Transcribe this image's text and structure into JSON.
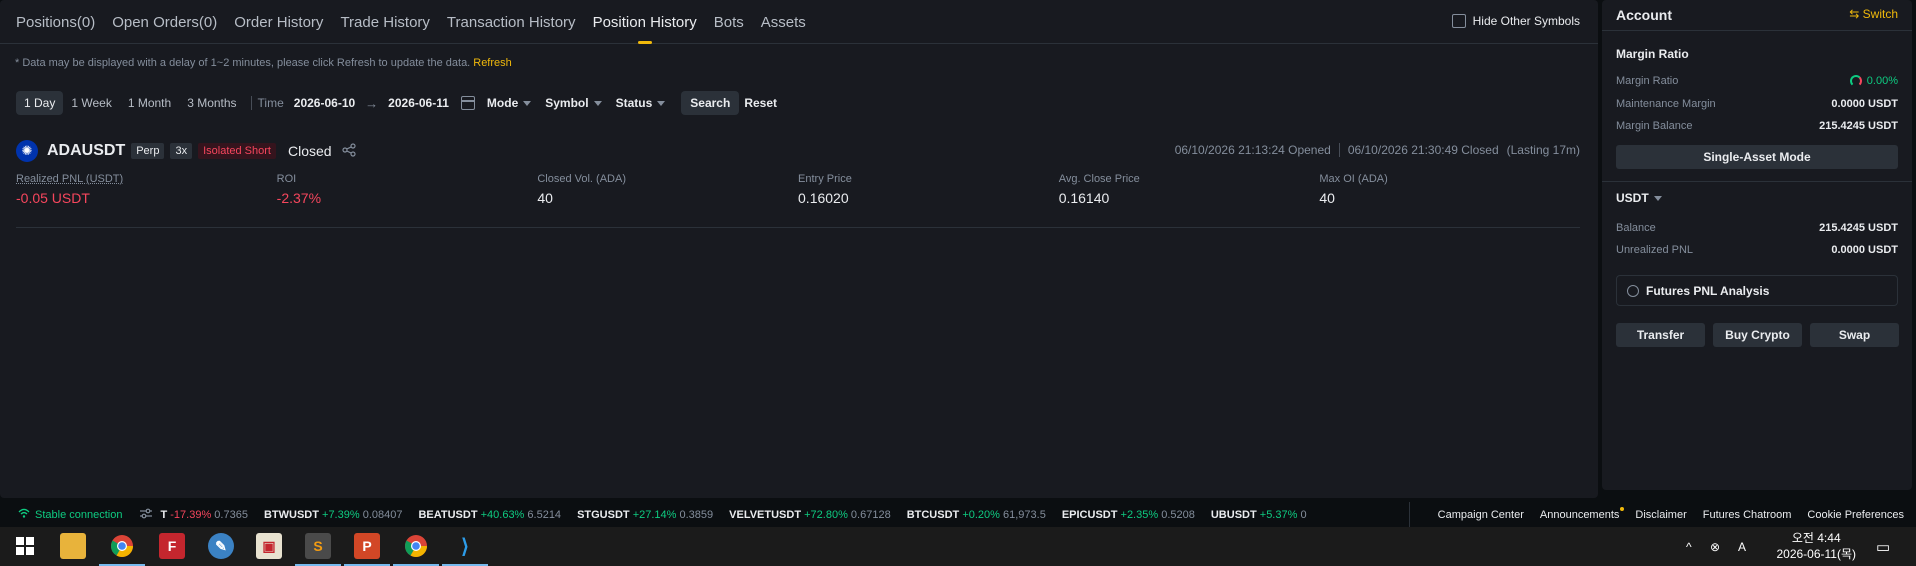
{
  "tabs": [
    {
      "label": "Positions(0)"
    },
    {
      "label": "Open Orders(0)"
    },
    {
      "label": "Order History"
    },
    {
      "label": "Trade History"
    },
    {
      "label": "Transaction History"
    },
    {
      "label": "Position History"
    },
    {
      "label": "Bots"
    },
    {
      "label": "Assets"
    }
  ],
  "active_tab": "Position History",
  "hide_other_symbols": "Hide Other Symbols",
  "notice": {
    "text": "* Data may be displayed with a delay of 1~2 minutes, please click Refresh to update the data.",
    "refresh": "Refresh"
  },
  "filters": {
    "ranges": [
      "1 Day",
      "1 Week",
      "1 Month",
      "3 Months"
    ],
    "active_range": "1 Day",
    "time_label": "Time",
    "date_from": "2026-06-10",
    "date_to": "2026-06-11",
    "mode": "Mode",
    "symbol": "Symbol",
    "status": "Status",
    "search": "Search",
    "reset": "Reset"
  },
  "position": {
    "symbol": "ADAUSDT",
    "type_tag": "Perp",
    "leverage_tag": "3x",
    "side_tag": "Isolated Short",
    "status": "Closed",
    "opened": "06/10/2026 21:13:24 Opened",
    "closed": "06/10/2026 21:30:49 Closed",
    "lasting": "(Lasting 17m)",
    "stats": [
      {
        "label": "Realized PNL (USDT)",
        "value": "-0.05 USDT",
        "negative": true
      },
      {
        "label": "ROI",
        "value": "-2.37%",
        "negative": true
      },
      {
        "label": "Closed Vol. (ADA)",
        "value": "40",
        "negative": false
      },
      {
        "label": "Entry Price",
        "value": "0.16020",
        "negative": false
      },
      {
        "label": "Avg. Close Price",
        "value": "0.16140",
        "negative": false
      },
      {
        "label": "Max OI (ADA)",
        "value": "40",
        "negative": false
      }
    ]
  },
  "account": {
    "title": "Account",
    "switch": "Switch",
    "margin_ratio_section": "Margin Ratio",
    "margin_ratio_label": "Margin Ratio",
    "margin_ratio_value": "0.00%",
    "maintenance_margin_label": "Maintenance Margin",
    "maintenance_margin_value": "0.0000 USDT",
    "margin_balance_label": "Margin Balance",
    "margin_balance_value": "215.4245 USDT",
    "single_asset_mode": "Single-Asset Mode",
    "asset": "USDT",
    "balance_label": "Balance",
    "balance_value": "215.4245 USDT",
    "unrealized_pnl_label": "Unrealized PNL",
    "unrealized_pnl_value": "0.0000 USDT",
    "pnl_analysis": "Futures PNL Analysis",
    "transfer": "Transfer",
    "buy_crypto": "Buy Crypto",
    "swap": "Swap"
  },
  "ticker": {
    "connection": "Stable connection",
    "items": [
      {
        "name": "T",
        "change": "-17.39%",
        "price": "0.7365",
        "up": false
      },
      {
        "name": "BTWUSDT",
        "change": "+7.39%",
        "price": "0.08407",
        "up": true
      },
      {
        "name": "BEATUSDT",
        "change": "+40.63%",
        "price": "6.5214",
        "up": true
      },
      {
        "name": "STGUSDT",
        "change": "+27.14%",
        "price": "0.3859",
        "up": true
      },
      {
        "name": "VELVETUSDT",
        "change": "+72.80%",
        "price": "0.67128",
        "up": true
      },
      {
        "name": "BTCUSDT",
        "change": "+0.20%",
        "price": "61,973.5",
        "up": true
      },
      {
        "name": "EPICUSDT",
        "change": "+2.35%",
        "price": "0.5208",
        "up": true
      },
      {
        "name": "UBUSDT",
        "change": "+5.37%",
        "price": "0",
        "up": true
      }
    ],
    "links": [
      "Campaign Center",
      "Announcements",
      "Disclaimer",
      "Futures Chatroom",
      "Cookie Preferences"
    ]
  },
  "taskbar": {
    "time": "오전 4:44",
    "date": "2026-06-11(목)",
    "ime": "A"
  }
}
